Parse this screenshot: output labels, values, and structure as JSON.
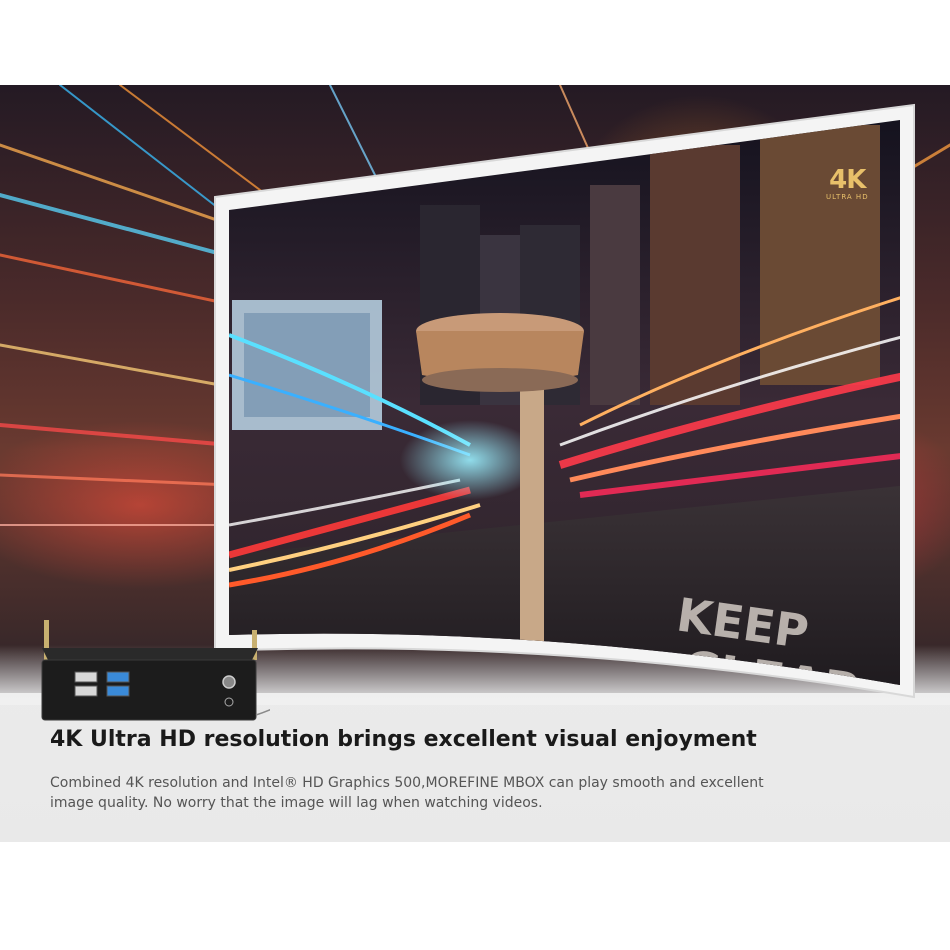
{
  "badge": {
    "big": "4K",
    "small": "ULTRA HD"
  },
  "headline": "4K Ultra HD resolution brings excellent visual enjoyment",
  "description_lines": [
    "Combined 4K resolution and Intel® HD Graphics 500,MOREFINE MBOX can play smooth and excellent",
    "image quality. No worry that the image will lag when watching videos."
  ],
  "colors": {
    "badge_gold": "#e8c06a",
    "headline": "#1a1a1a",
    "body_text": "#555555",
    "banner_bg": "#f0f0f0"
  }
}
